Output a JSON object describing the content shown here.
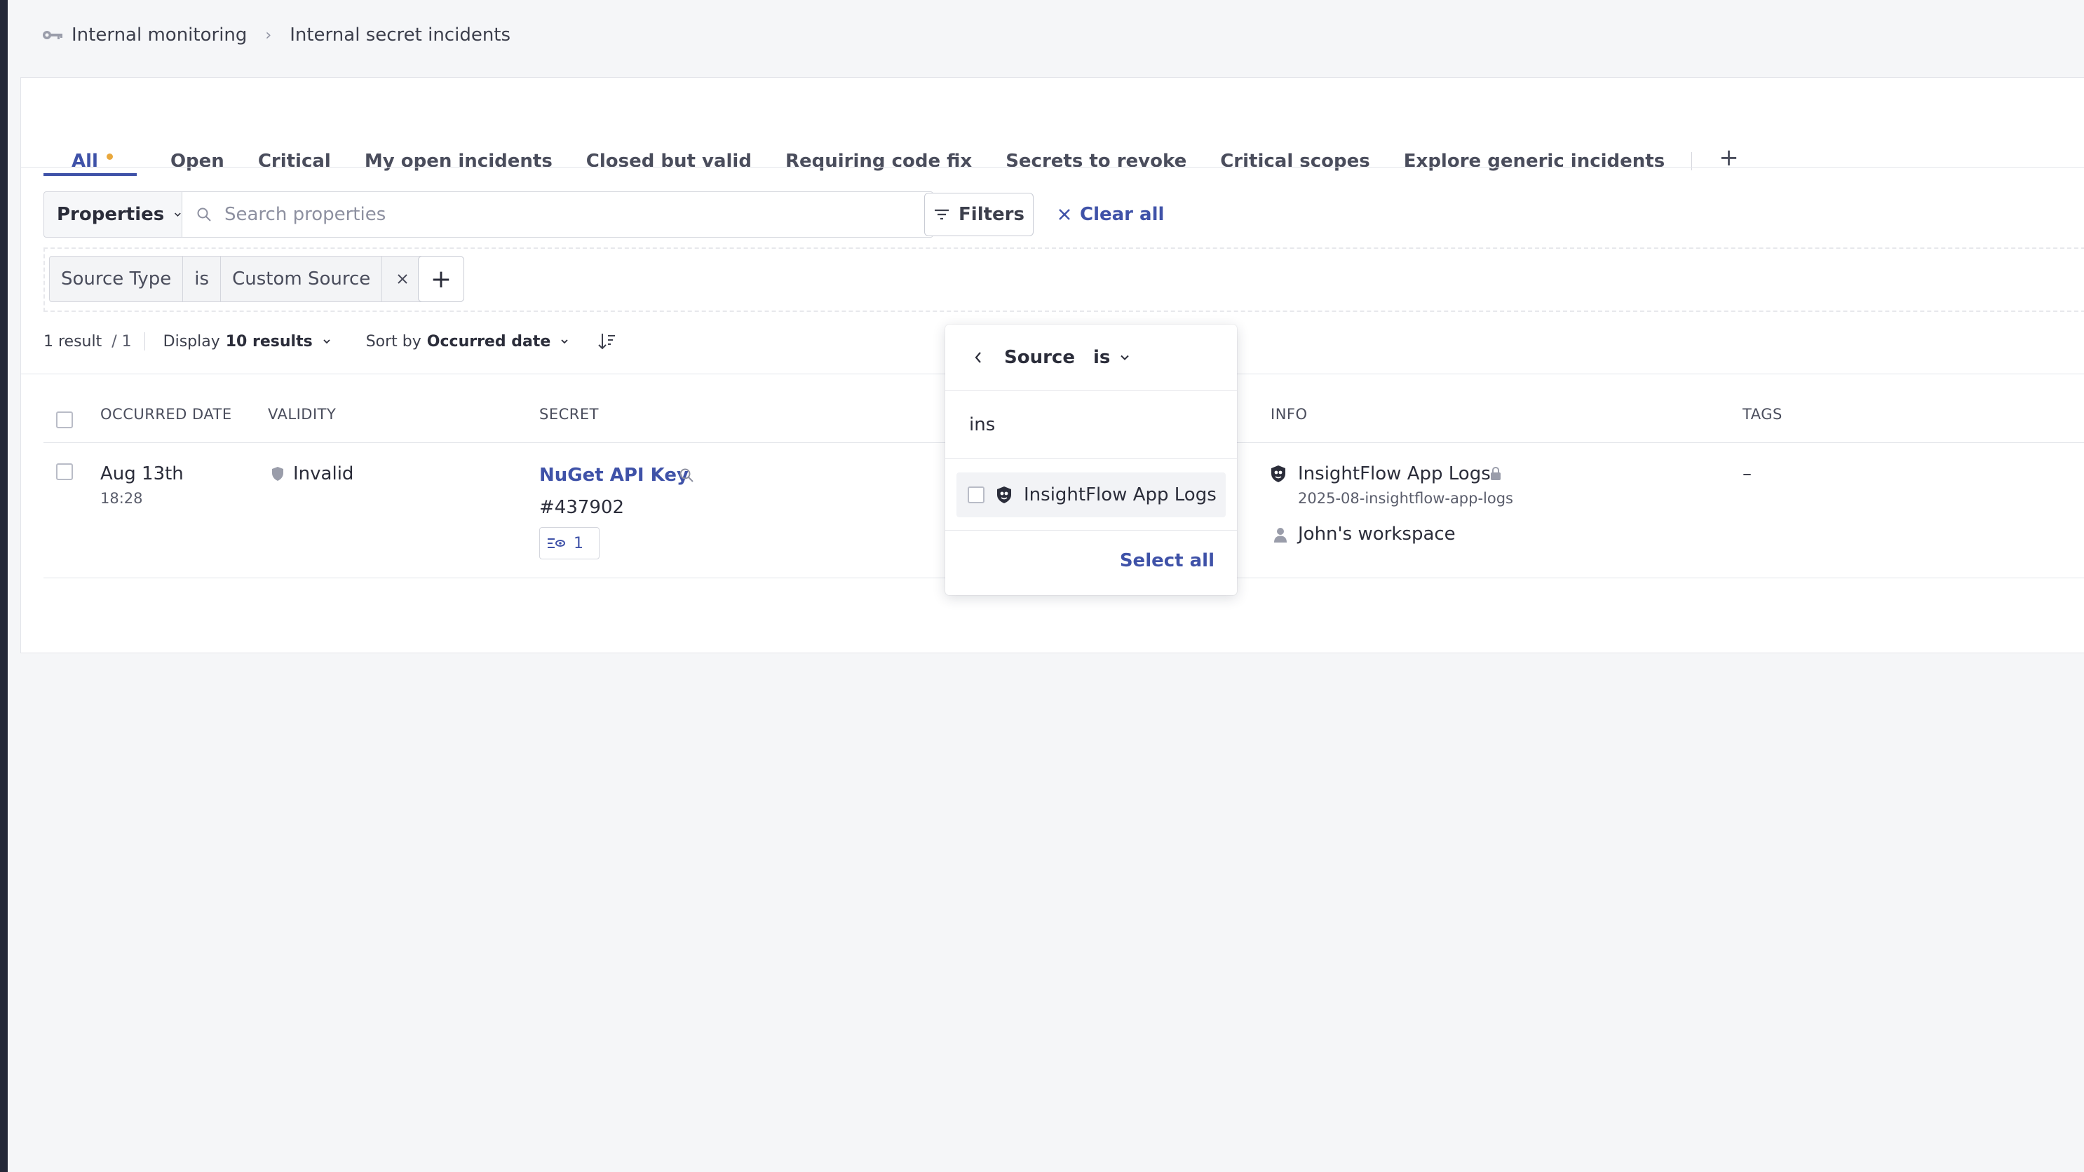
{
  "breadcrumb": {
    "root": "Internal monitoring",
    "current": "Internal secret incidents"
  },
  "tabs": [
    {
      "label": "All",
      "active": true
    },
    {
      "label": "Open"
    },
    {
      "label": "Critical"
    },
    {
      "label": "My open incidents"
    },
    {
      "label": "Closed but valid"
    },
    {
      "label": "Requiring code fix"
    },
    {
      "label": "Secrets to revoke"
    },
    {
      "label": "Critical scopes"
    },
    {
      "label": "Explore generic incidents"
    }
  ],
  "tab_add": "+",
  "search": {
    "properties_label": "Properties",
    "placeholder": "Search properties",
    "filters_label": "Filters",
    "clear_label": "Clear all"
  },
  "active_filter": {
    "field": "Source Type",
    "operator": "is",
    "value": "Custom Source"
  },
  "add_filter": "+",
  "results": {
    "count": "1 result",
    "pages": "/  1",
    "display_prefix": "Display",
    "display_value": "10 results",
    "sort_prefix": "Sort by",
    "sort_value": "Occurred date"
  },
  "table": {
    "headers": {
      "occurred": "OCCURRED DATE",
      "validity": "VALIDITY",
      "secret": "SECRET",
      "info": "INFO",
      "tags": "TAGS"
    },
    "row": {
      "date": "Aug 13th",
      "time": "18:28",
      "validity": "Invalid",
      "secret_name": "NuGet API Key",
      "secret_id": "#437902",
      "occurrences": "1",
      "info_source": "InsightFlow App Logs",
      "info_sub": "2025-08-insightflow-app-logs",
      "info_workspace": "John's workspace",
      "tags": "–"
    }
  },
  "dropdown": {
    "field": "Source",
    "operator": "is",
    "query": "ins",
    "option": "InsightFlow App Logs",
    "select_all": "Select all"
  },
  "colors": {
    "accent": "#3f52a8",
    "tab_dot": "#e9a83c",
    "rail": "#242838"
  }
}
